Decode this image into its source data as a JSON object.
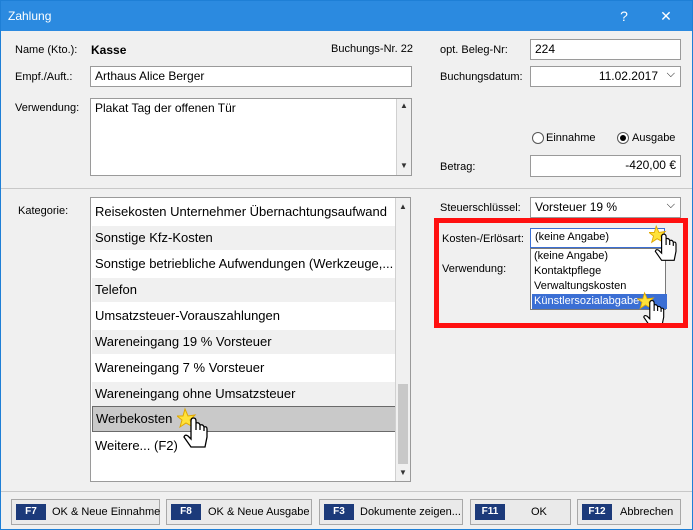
{
  "window": {
    "title": "Zahlung",
    "help_glyph": "?",
    "close_glyph": "✕"
  },
  "header": {
    "name_label": "Name (Kto.):",
    "name_value": "Kasse",
    "buchungs_nr_label": "Buchungs-Nr. 22",
    "empf_label": "Empf./Auft.:",
    "empf_value": "Arthaus Alice Berger",
    "verwendung_label": "Verwendung:",
    "verwendung_value": "Plakat Tag der offenen Tür"
  },
  "right_top": {
    "beleg_label": "opt. Beleg-Nr:",
    "beleg_value": "224",
    "datum_label": "Buchungsdatum:",
    "datum_value": "11.02.2017",
    "radio_einnahme": "Einnahme",
    "radio_ausgabe": "Ausgabe",
    "selected_radio": "Ausgabe",
    "betrag_label": "Betrag:",
    "betrag_value": "-420,00 €"
  },
  "kategorie": {
    "label": "Kategorie:",
    "items": [
      "Reisekosten Unternehmer Übernachtungsaufwand",
      "Sonstige Kfz-Kosten",
      "Sonstige betriebliche Aufwendungen (Werkzeuge,...",
      "Telefon",
      "Umsatzsteuer-Vorauszahlungen",
      "Wareneingang 19 % Vorsteuer",
      "Wareneingang 7 % Vorsteuer",
      "Wareneingang ohne Umsatzsteuer",
      "Werbekosten",
      "Weitere... (F2)"
    ],
    "selected": "Werbekosten"
  },
  "right_bottom": {
    "steuer_label": "Steuerschlüssel:",
    "steuer_value": "Vorsteuer 19 %",
    "kosten_label": "Kosten-/Erlösart:",
    "kosten_value": "(keine Angabe)",
    "verwendung2_label": "Verwendung:",
    "dropdown_options": [
      "(keine Angabe)",
      "Kontaktpflege",
      "Verwaltungskosten",
      "Künstlersozialabgabe"
    ],
    "dropdown_highlighted": "Künstlersozialabgabe"
  },
  "footer": {
    "buttons": [
      {
        "key": "F7",
        "label": "OK & Neue Einnahme"
      },
      {
        "key": "F8",
        "label": "OK & Neue Ausgabe"
      },
      {
        "key": "F3",
        "label": "Dokumente zeigen..."
      },
      {
        "key": "F11",
        "label": "OK"
      },
      {
        "key": "F12",
        "label": "Abbrechen"
      }
    ]
  },
  "colors": {
    "titlebar": "#2b8ae0",
    "highlight_box": "#ff1010",
    "dropdown_selection": "#3b6fd4",
    "fkey_badge": "#1c3a7a"
  },
  "icons": [
    "help-icon",
    "close-icon",
    "chevron-down-icon",
    "hand-cursor-icon",
    "click-spark-icon"
  ]
}
